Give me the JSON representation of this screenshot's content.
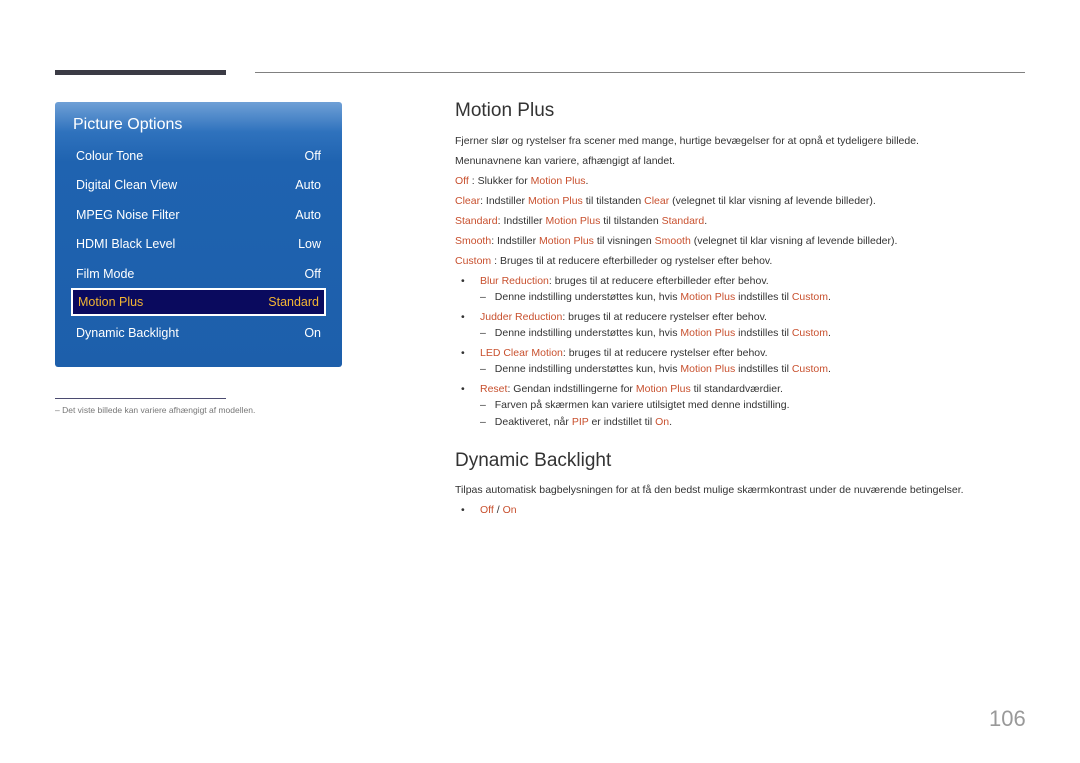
{
  "menu": {
    "title": "Picture Options",
    "items": [
      {
        "label": "Colour Tone",
        "value": "Off"
      },
      {
        "label": "Digital Clean View",
        "value": "Auto"
      },
      {
        "label": "MPEG Noise Filter",
        "value": "Auto"
      },
      {
        "label": "HDMI Black Level",
        "value": "Low"
      },
      {
        "label": "Film Mode",
        "value": "Off"
      },
      {
        "label": "Motion Plus",
        "value": "Standard",
        "selected": true
      },
      {
        "label": "Dynamic Backlight",
        "value": "On"
      }
    ]
  },
  "footnote": "–  Det viste billede kan variere afhængigt af modellen.",
  "motion_plus": {
    "heading": "Motion Plus",
    "desc1": "Fjerner slør og rystelser fra scener med mange, hurtige bevægelser for at opnå et tydeligere billede.",
    "desc2": "Menunavnene kan variere, afhængigt af landet.",
    "off": {
      "k": "Off",
      "t1": " : Slukker for ",
      "h1": "Motion Plus",
      "t2": "."
    },
    "clear": {
      "k": "Clear",
      "t1": ": Indstiller ",
      "h1": "Motion Plus",
      "t2": " til tilstanden ",
      "h2": "Clear",
      "t3": " (velegnet til klar visning af levende billeder)."
    },
    "standard": {
      "k": "Standard",
      "t1": ": Indstiller ",
      "h1": "Motion Plus",
      "t2": " til tilstanden ",
      "h2": "Standard",
      "t3": "."
    },
    "smooth": {
      "k": "Smooth",
      "t1": ": Indstiller ",
      "h1": "Motion Plus",
      "t2": " til visningen ",
      "h2": "Smooth",
      "t3": " (velegnet til klar visning af levende billeder)."
    },
    "custom": {
      "k": "Custom",
      "t1": " : Bruges til at reducere efterbilleder og rystelser efter behov."
    },
    "bullets": [
      {
        "k": "Blur Reduction",
        "t": ": bruges til at reducere efterbilleder efter behov."
      },
      {
        "k": "Judder Reduction",
        "t": ": bruges til at reducere rystelser efter behov."
      },
      {
        "k": "LED Clear Motion",
        "t": ": bruges til at reducere rystelser efter behov."
      },
      {
        "k": "Reset",
        "t1": ": Gendan indstillingerne for ",
        "h1": "Motion Plus",
        "t2": " til standardværdier."
      }
    ],
    "sub_note": {
      "t1": "Denne indstilling understøttes kun, hvis ",
      "h1": "Motion Plus",
      "t2": " indstilles til ",
      "h2": "Custom",
      "t3": "."
    },
    "reset_note1": "Farven på skærmen kan variere utilsigtet med denne indstilling.",
    "reset_note2": {
      "t1": "Deaktiveret, når ",
      "h1": "PIP",
      "t2": " er indstillet til ",
      "h2": "On",
      "t3": "."
    },
    "dash": "–",
    "bullet": "•"
  },
  "dynamic_backlight": {
    "heading": "Dynamic Backlight",
    "desc": "Tilpas automatisk bagbelysningen for at få den bedst mulige skærmkontrast under de nuværende betingelser.",
    "opt_off": "Off",
    "sep": " / ",
    "opt_on": "On"
  },
  "page_number": "106",
  "colors": {
    "accent": "#c8502e",
    "menu_blue": "#1f63b0",
    "selected_text": "#f2b534"
  }
}
